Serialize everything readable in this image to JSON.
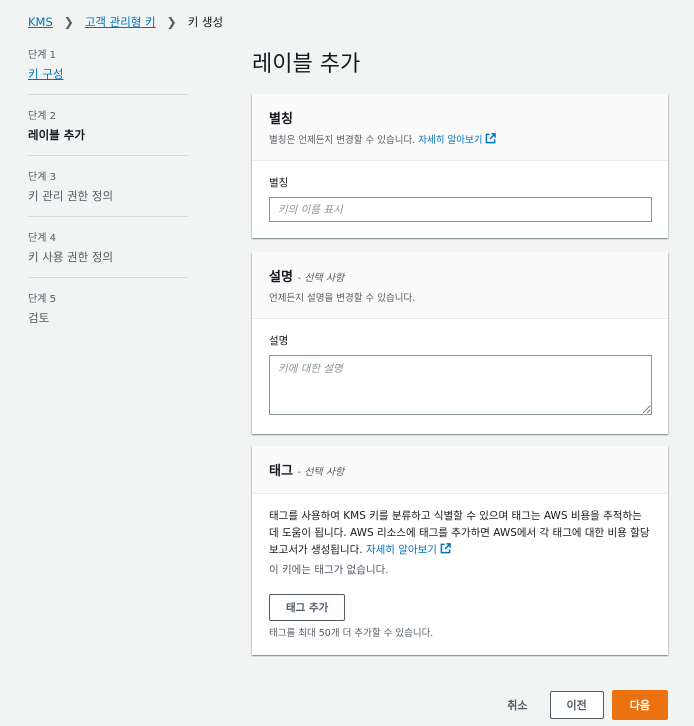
{
  "breadcrumb": {
    "items": [
      "KMS",
      "고객 관리형 키"
    ],
    "current": "키 생성"
  },
  "steps": [
    {
      "num": "단계 1",
      "label": "키 구성"
    },
    {
      "num": "단계 2",
      "label": "레이블 추가"
    },
    {
      "num": "단계 3",
      "label": "키 관리 권한 정의"
    },
    {
      "num": "단계 4",
      "label": "키 사용 권한 정의"
    },
    {
      "num": "단계 5",
      "label": "검토"
    }
  ],
  "page_title": "레이블 추가",
  "alias_panel": {
    "title": "별칭",
    "desc": "별칭은 언제든지 변경할 수 있습니다.",
    "learn_more": "자세히 알아보기",
    "field_label": "별칭",
    "placeholder": "키의 이름 표시",
    "value": ""
  },
  "description_panel": {
    "title": "설명",
    "optional": "- 선택 사항",
    "desc": "언제든지 설명을 변경할 수 있습니다.",
    "field_label": "설명",
    "placeholder": "키에 대한 설명",
    "value": ""
  },
  "tags_panel": {
    "title": "태그",
    "optional": "- 선택 사항",
    "body_text": "태그를 사용하여 KMS 키를 분류하고 식별할 수 있으며 태그는 AWS 비용을 추적하는 데 도움이 됩니다. AWS 리소스에 태그를 추가하면 AWS에서 각 태그에 대한 비용 할당 보고서가 생성됩니다.",
    "learn_more": "자세히 알아보기",
    "no_tags": "이 키에는 태그가 없습니다.",
    "add_button": "태그 추가",
    "hint": "태그를 최대 50개 더 추가할 수 있습니다."
  },
  "footer": {
    "cancel": "취소",
    "previous": "이전",
    "next": "다음"
  },
  "colors": {
    "link": "#0073bb",
    "primary": "#ec7211",
    "background": "#f2f3f3"
  }
}
